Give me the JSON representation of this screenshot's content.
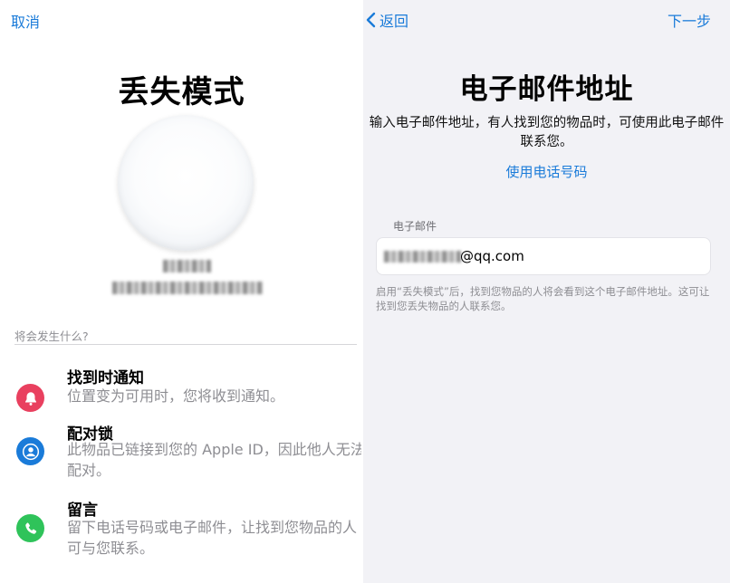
{
  "left": {
    "nav": {
      "cancel_label": "取消"
    },
    "title": "丢失模式",
    "section_label": "将会发生什么?",
    "features": [
      {
        "title": "找到时通知",
        "description": "位置变为可用时，您将收到通知。",
        "icon": "bell-icon",
        "icon_color": "#e9405f"
      },
      {
        "title": "配对锁",
        "description": "此物品已链接到您的 Apple ID，因此他人无法配对。",
        "icon": "person-icon",
        "icon_color": "#1a7bd9"
      },
      {
        "title": "留言",
        "description": "留下电话号码或电子邮件，让找到您物品的人可与您联系。",
        "icon": "phone-icon",
        "icon_color": "#2fc35a"
      }
    ]
  },
  "right": {
    "nav": {
      "back_label": "返回",
      "next_label": "下一步"
    },
    "title": "电子邮件地址",
    "description": "输入电子邮件地址，有人找到您的物品时，可使用此电子邮件联系您。",
    "use_phone_link": "使用电话号码",
    "field_label": "电子邮件",
    "email_value_visible": "@qq.com",
    "footnote": "启用“丢失模式”后，找到您物品的人将会看到这个电子邮件地址。这可让找到您丢失物品的人联系您。"
  },
  "colors": {
    "accent": "#1a7bd9",
    "secondary_text": "#8e8e93",
    "right_background": "#f2f2f6"
  }
}
